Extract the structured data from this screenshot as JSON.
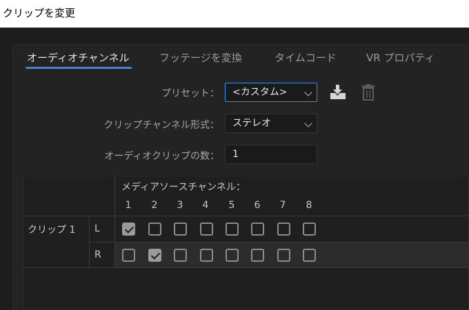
{
  "window": {
    "title": "クリップを変更"
  },
  "tabs": [
    {
      "label": "オーディオチャンネル",
      "active": true
    },
    {
      "label": "フッテージを変換",
      "active": false
    },
    {
      "label": "タイムコード",
      "active": false
    },
    {
      "label": "VR プロパティ",
      "active": false
    }
  ],
  "preset": {
    "label": "プリセット：",
    "value": "<カスタム>",
    "save_icon": "download-preset-icon",
    "delete_icon": "trash-icon"
  },
  "format": {
    "label": "クリップチャンネル形式：",
    "value": "ステレオ"
  },
  "clip_count": {
    "label": "オーディオクリップの数：",
    "value": "1"
  },
  "matrix": {
    "header": "メディアソースチャンネル：",
    "channels": [
      "1",
      "2",
      "3",
      "4",
      "5",
      "6",
      "7",
      "8"
    ],
    "clip_label": "クリップ 1",
    "rows": [
      {
        "channel": "L",
        "checked": [
          true,
          false,
          false,
          false,
          false,
          false,
          false,
          false
        ]
      },
      {
        "channel": "R",
        "checked": [
          false,
          true,
          false,
          false,
          false,
          false,
          false,
          false
        ]
      }
    ]
  },
  "colors": {
    "accent": "#2d8ceb",
    "background": "#232323"
  }
}
